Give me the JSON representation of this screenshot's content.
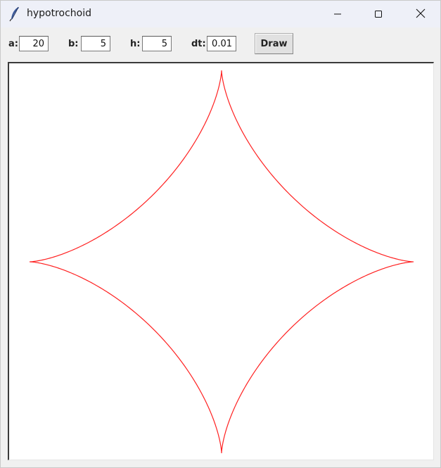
{
  "window": {
    "title": "hypotrochoid",
    "icon": "feather-icon"
  },
  "controls": {
    "a": {
      "label": "a:",
      "value": "20"
    },
    "b": {
      "label": "b:",
      "value": "5"
    },
    "h": {
      "label": "h:",
      "value": "5"
    },
    "dt": {
      "label": "dt:",
      "value": "0.01"
    },
    "draw_label": "Draw"
  },
  "curve": {
    "color": "#ff2020",
    "a": 20,
    "b": 5,
    "h": 5,
    "dt": 0.01
  }
}
